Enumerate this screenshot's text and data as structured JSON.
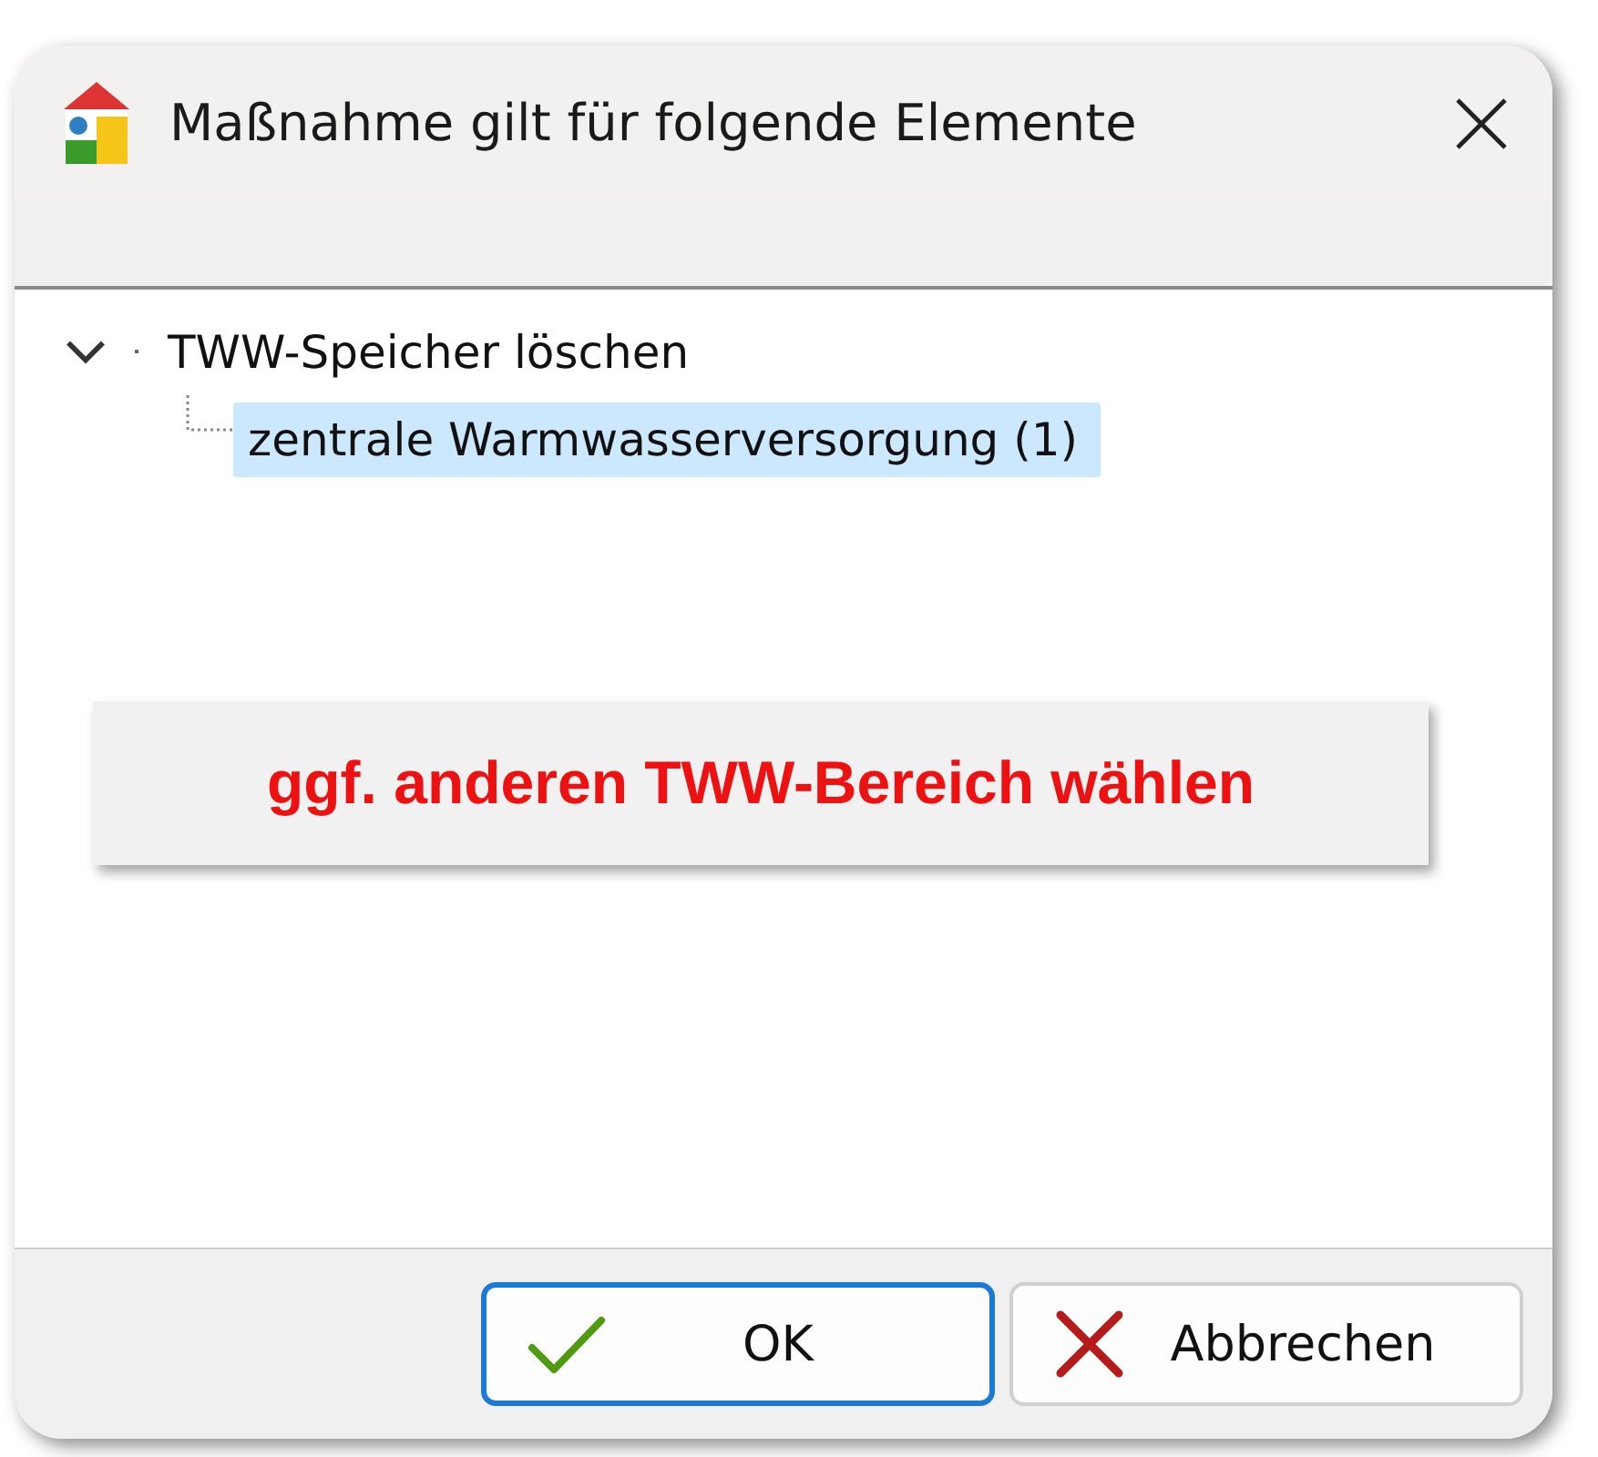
{
  "window": {
    "title": "Maßnahme gilt für folgende Elemente"
  },
  "tree": [
    {
      "label": "TWW-Speicher löschen",
      "expanded": true,
      "selected": false,
      "children": [
        {
          "label": "zentrale Warmwasserversorgung (1)",
          "selected": true
        }
      ]
    }
  ],
  "note": "ggf. anderen TWW-Bereich wählen",
  "buttons": [
    {
      "label": "OK",
      "kind": "ok",
      "default": true
    },
    {
      "label": "Abbrechen",
      "kind": "cancel",
      "default": false
    }
  ]
}
